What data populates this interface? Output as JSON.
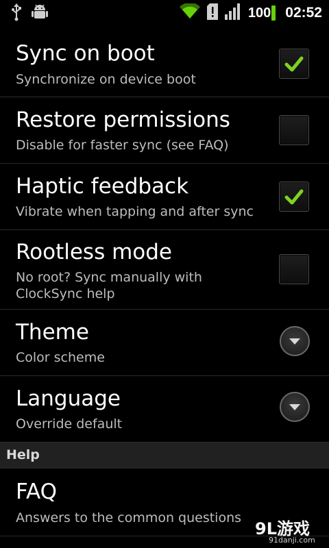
{
  "status_bar": {
    "left_icons": [
      "usb-icon",
      "android-debug-icon"
    ],
    "right_icons": [
      "wifi-icon",
      "sd-card-alert-icon",
      "signal-icon"
    ],
    "battery_level": "100",
    "time": "02:52",
    "battery_color": "#66d20a",
    "wifi_color": "#66d20a"
  },
  "prefs": {
    "sync_on_boot": {
      "title": "Sync on boot",
      "summary": "Synchronize on device boot",
      "checked": true
    },
    "restore_permissions": {
      "title": "Restore permissions",
      "summary": "Disable for faster sync (see FAQ)",
      "checked": false
    },
    "haptic_feedback": {
      "title": "Haptic feedback",
      "summary": "Vibrate when tapping and after sync",
      "checked": true
    },
    "rootless_mode": {
      "title": "Rootless mode",
      "summary": "No root? Sync manually with ClockSync help",
      "checked": false
    },
    "theme": {
      "title": "Theme",
      "summary": "Color scheme",
      "icon": "dropdown-arrow-icon"
    },
    "language": {
      "title": "Language",
      "summary": "Override default",
      "icon": "dropdown-arrow-icon"
    }
  },
  "help_section": {
    "header": "Help",
    "faq": {
      "title": "FAQ",
      "summary": "Answers to the common questions"
    }
  },
  "watermark": {
    "main": "9L游戏",
    "sub": "91danji.com"
  },
  "colors": {
    "background": "#000000",
    "check_green": "#7ed321",
    "section_header_bg": "#212121",
    "summary_text": "#bdbdbd"
  }
}
